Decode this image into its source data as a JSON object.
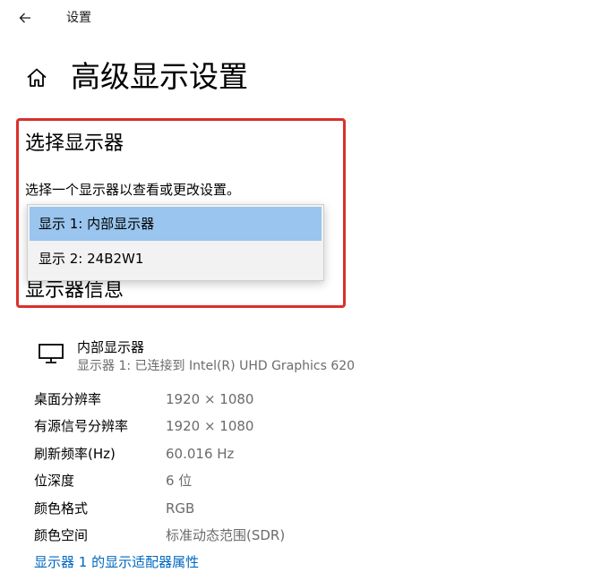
{
  "titlebar": {
    "back_icon": "arrow-left-icon",
    "app_title": "设置"
  },
  "page": {
    "home_icon": "home-icon",
    "title": "高级显示设置"
  },
  "select_display": {
    "heading": "选择显示器",
    "description": "选择一个显示器以查看或更改设置。",
    "options": [
      {
        "label": "显示 1: 内部显示器",
        "selected": true
      },
      {
        "label": "显示 2: 24B2W1",
        "selected": false
      }
    ]
  },
  "display_info": {
    "heading": "显示器信息",
    "monitor_icon": "monitor-icon",
    "display_name": "内部显示器",
    "display_sub": "显示器 1: 已连接到 Intel(R) UHD Graphics 620",
    "rows": [
      {
        "label": "桌面分辨率",
        "value": "1920 × 1080"
      },
      {
        "label": "有源信号分辨率",
        "value": "1920 × 1080"
      },
      {
        "label": "刷新频率(Hz)",
        "value": "60.016 Hz"
      },
      {
        "label": "位深度",
        "value": "6 位"
      },
      {
        "label": "颜色格式",
        "value": "RGB"
      },
      {
        "label": "颜色空间",
        "value": "标准动态范围(SDR)"
      }
    ],
    "adapter_link": "显示器 1 的显示适配器属性"
  },
  "colors": {
    "highlight_border": "#d9302c",
    "selected_option": "#99c5ee",
    "link": "#0067c0",
    "secondary_text": "#6b6b6b"
  }
}
